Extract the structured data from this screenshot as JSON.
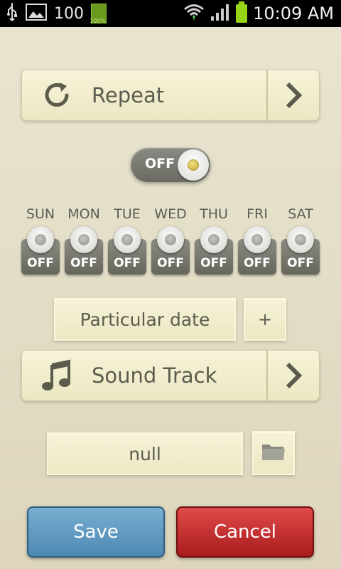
{
  "status_bar": {
    "battery_level_text": "100",
    "battery_icon_text": "100%",
    "time": "10:09 AM",
    "icons": [
      "usb-icon",
      "image-icon",
      "battery-icon",
      "wifi-icon",
      "signal-icon",
      "battery-charging-icon"
    ]
  },
  "repeat": {
    "label": "Repeat",
    "icon": "refresh-icon",
    "arrow_icon": "chevron-right-icon"
  },
  "main_toggle": {
    "label": "OFF",
    "state": "off"
  },
  "days": [
    {
      "name": "SUN",
      "state": "OFF"
    },
    {
      "name": "MON",
      "state": "OFF"
    },
    {
      "name": "TUE",
      "state": "OFF"
    },
    {
      "name": "WED",
      "state": "OFF"
    },
    {
      "name": "THU",
      "state": "OFF"
    },
    {
      "name": "FRI",
      "state": "OFF"
    },
    {
      "name": "SAT",
      "state": "OFF"
    }
  ],
  "particular_date": {
    "label": "Particular date",
    "add_label": "+"
  },
  "sound_track": {
    "label": "Sound Track",
    "icon": "music-note-icon",
    "arrow_icon": "chevron-right-icon"
  },
  "file": {
    "value": "null",
    "browse_icon": "folder-icon"
  },
  "actions": {
    "save_label": "Save",
    "cancel_label": "Cancel"
  },
  "colors": {
    "background": "#e6e1cb",
    "panel": "#f2eecf",
    "save": "#5f97bf",
    "cancel": "#c22b2b",
    "statusbar": "#000000"
  }
}
